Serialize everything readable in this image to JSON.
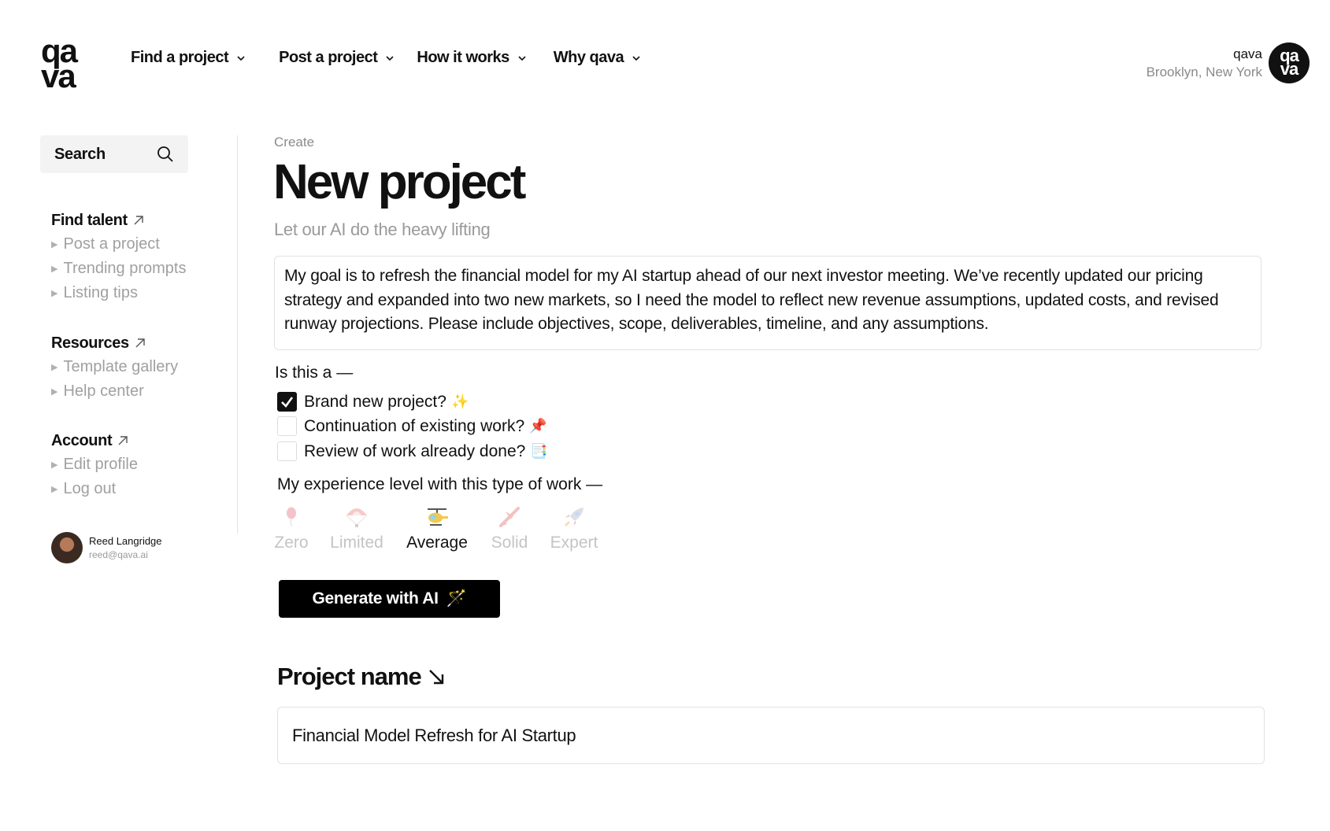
{
  "brand": {
    "logo_line1": "qa",
    "logo_line2": "va"
  },
  "topnav": [
    {
      "label": "Find a project"
    },
    {
      "label": "Post a project"
    },
    {
      "label": "How it works"
    },
    {
      "label": "Why qava"
    }
  ],
  "account_header": {
    "name": "qava",
    "location": "Brooklyn, New York",
    "avatar_line1": "qa",
    "avatar_line2": "va"
  },
  "sidebar": {
    "search_label": "Search",
    "sections": [
      {
        "title": "Find talent",
        "items": [
          "Post a project",
          "Trending prompts",
          "Listing tips"
        ]
      },
      {
        "title": "Resources",
        "items": [
          "Template gallery",
          "Help center"
        ]
      },
      {
        "title": "Account",
        "items": [
          "Edit profile",
          "Log out"
        ]
      }
    ],
    "user": {
      "name": "Reed Langridge",
      "email": "reed@qava.ai"
    }
  },
  "main": {
    "breadcrumb": "Create",
    "title": "New project",
    "subtitle": "Let our AI do the heavy lifting",
    "goal_text": "My goal is to refresh the financial model for my AI startup ahead of our next investor meeting. We’ve recently updated our pricing strategy and expanded into two new markets, so I need the model to reflect new revenue assumptions, updated costs, and revised runway projections. Please include objectives, scope, deliverables, timeline, and any assumptions.",
    "type_question": "Is this a —",
    "type_options": [
      {
        "label": "Brand new project?",
        "emoji": "✨",
        "checked": true
      },
      {
        "label": "Continuation of existing work?",
        "emoji": "📌",
        "checked": false
      },
      {
        "label": "Review of work already done?",
        "emoji": "📑",
        "checked": false
      }
    ],
    "experience_question": "My experience level with this type of work —",
    "experience_levels": [
      {
        "label": "Zero",
        "icon": "balloon-icon"
      },
      {
        "label": "Limited",
        "icon": "parachute-icon"
      },
      {
        "label": "Average",
        "icon": "helicopter-icon"
      },
      {
        "label": "Solid",
        "icon": "airplane-icon"
      },
      {
        "label": "Expert",
        "icon": "rocket-icon"
      }
    ],
    "experience_selected": "Average",
    "generate_label": "Generate with AI",
    "generate_emoji": "🪄",
    "project_name_heading": "Project name",
    "project_name_value": "Financial Model Refresh for AI Startup"
  }
}
